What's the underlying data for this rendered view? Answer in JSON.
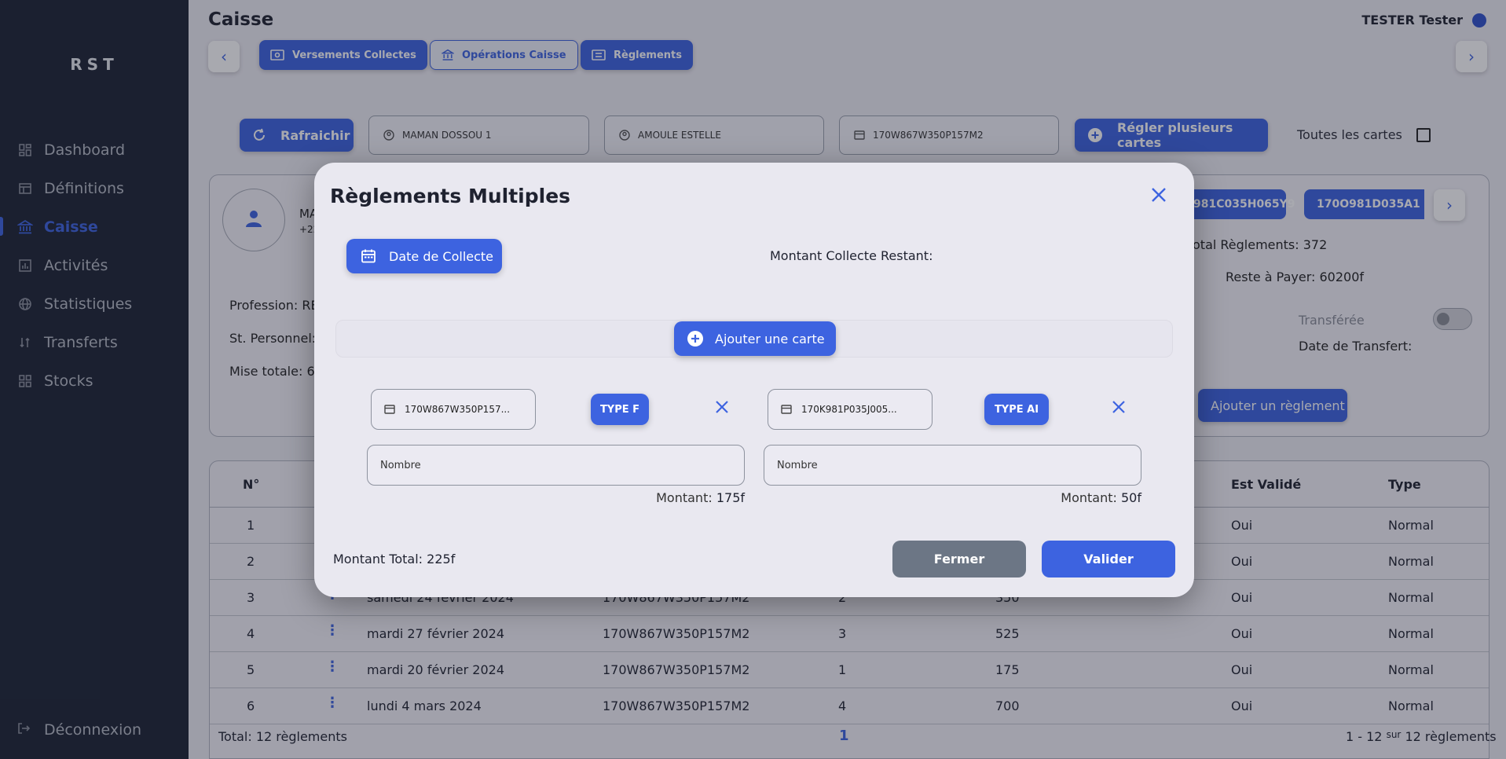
{
  "sidebar": {
    "brand": "RST",
    "items": [
      {
        "label": "Dashboard",
        "icon": "dashboard-icon"
      },
      {
        "label": "Définitions",
        "icon": "table-icon"
      },
      {
        "label": "Caisse",
        "icon": "bank-icon"
      },
      {
        "label": "Activités",
        "icon": "chart-icon"
      },
      {
        "label": "Statistiques",
        "icon": "globe-icon"
      },
      {
        "label": "Transferts",
        "icon": "transfer-icon"
      },
      {
        "label": "Stocks",
        "icon": "grid-icon"
      }
    ],
    "active": "Caisse",
    "logout": "Déconnexion"
  },
  "header": {
    "title": "Caisse",
    "user": "TESTER Tester"
  },
  "tabs": [
    {
      "label": "Versements Collectes",
      "icon": "money-icon"
    },
    {
      "label": "Opérations Caisse",
      "icon": "bank-icon"
    },
    {
      "label": "Règlements",
      "icon": "bill-icon"
    }
  ],
  "toolbar": {
    "refresh": "Rafraichir",
    "client": "MAMAN  DOSSOU 1",
    "agent": "AMOULE  ESTELLE",
    "card": "170W867W350P157M2",
    "multi": "Régler plusieurs cartes",
    "all_cards": "Toutes les cartes"
  },
  "client_card": {
    "name_partial": "MA",
    "phone_partial": "+22",
    "profession_label": "Profession:",
    "profession_partial": "REV",
    "st_personnel_label": "St. Personnel:",
    "mise_label": "Mise totale:",
    "mise_partial": "67",
    "chips": [
      "981C035H065Y9",
      "170O981D035A1"
    ],
    "total_reglements": "otal Règlements: 372",
    "reste_label": "Reste à Payer:",
    "reste_value": "60200f",
    "transferee": "Transférée",
    "date_transfert": "Date de Transfert:",
    "add_reglement": "Ajouter un règlement"
  },
  "table": {
    "headers": [
      "N°",
      "Est Validé",
      "Type"
    ],
    "rows": [
      {
        "n": "1",
        "date": "",
        "carte": "",
        "nb": "",
        "montant": "",
        "valide": "Oui",
        "type": "Normal"
      },
      {
        "n": "2",
        "date": "",
        "carte": "",
        "nb": "",
        "montant": "",
        "valide": "Oui",
        "type": "Normal"
      },
      {
        "n": "3",
        "date": "samedi 24 février 2024",
        "carte": "170W867W350P157M2",
        "nb": "2",
        "montant": "350",
        "valide": "Oui",
        "type": "Normal"
      },
      {
        "n": "4",
        "date": "mardi 27 février 2024",
        "carte": "170W867W350P157M2",
        "nb": "3",
        "montant": "525",
        "valide": "Oui",
        "type": "Normal"
      },
      {
        "n": "5",
        "date": "mardi 20 février 2024",
        "carte": "170W867W350P157M2",
        "nb": "1",
        "montant": "175",
        "valide": "Oui",
        "type": "Normal"
      },
      {
        "n": "6",
        "date": "lundi 4 mars 2024",
        "carte": "170W867W350P157M2",
        "nb": "4",
        "montant": "700",
        "valide": "Oui",
        "type": "Normal"
      }
    ],
    "total": "Total: 12 règlements",
    "page": "1",
    "range": "1 - 12",
    "range_sur": "sur",
    "range_total": "12 règlements"
  },
  "modal": {
    "title": "Règlements Multiples",
    "date_button": "Date de Collecte",
    "restant_label": "Montant Collecte Restant:",
    "add_card": "Ajouter une carte",
    "cards": [
      {
        "card": "170W867W350P157...",
        "type": "TYPE F",
        "nombre_placeholder": "Nombre",
        "montant_label": "Montant:",
        "montant_value": "175f"
      },
      {
        "card": "170K981P035J005...",
        "type": "TYPE AI",
        "nombre_placeholder": "Nombre",
        "montant_label": "Montant:",
        "montant_value": "50f"
      }
    ],
    "total_label": "Montant Total: 225f",
    "close_button": "Fermer",
    "validate_button": "Valider"
  },
  "colors": {
    "accent": "#3d63e0",
    "sidebar": "#1c2333",
    "grey_button": "#6c7685"
  }
}
